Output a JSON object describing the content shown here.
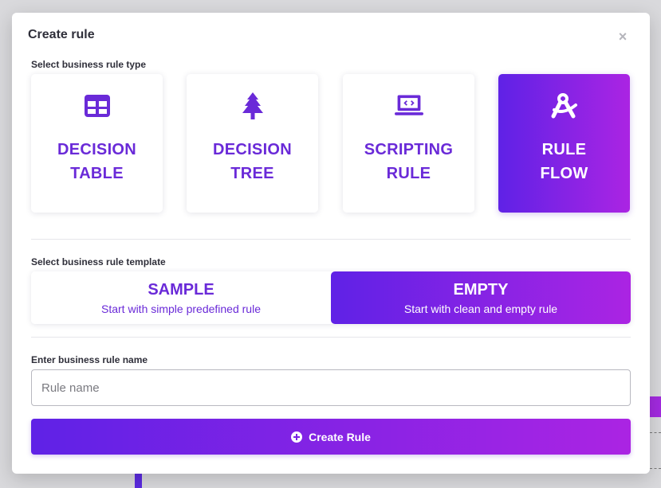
{
  "modal": {
    "title": "Create rule",
    "close_icon": "close-icon"
  },
  "rule_type": {
    "label": "Select business rule type",
    "options": [
      {
        "line1": "DECISION",
        "line2": "TABLE",
        "icon": "table-icon",
        "selected": false
      },
      {
        "line1": "DECISION",
        "line2": "TREE",
        "icon": "tree-icon",
        "selected": false
      },
      {
        "line1": "SCRIPTING",
        "line2": "RULE",
        "icon": "laptop-code-icon",
        "selected": false
      },
      {
        "line1": "RULE",
        "line2": "FLOW",
        "icon": "drafting-compass-icon",
        "selected": true
      }
    ]
  },
  "template": {
    "label": "Select business rule template",
    "options": [
      {
        "title": "SAMPLE",
        "description": "Start with simple predefined rule",
        "selected": false
      },
      {
        "title": "EMPTY",
        "description": "Start with clean and empty rule",
        "selected": true
      }
    ]
  },
  "name": {
    "label": "Enter business rule name",
    "placeholder": "Rule name",
    "value": ""
  },
  "create_button": {
    "label": "Create Rule",
    "icon": "plus-circle-icon"
  },
  "colors": {
    "accent_start": "#5f22e6",
    "accent_end": "#ab24e3",
    "accent_text": "#6a2ad8"
  }
}
